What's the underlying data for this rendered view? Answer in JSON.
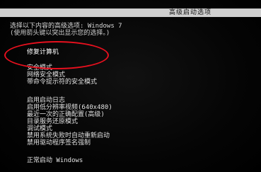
{
  "header": {
    "title": "高级启动选项"
  },
  "prompt": {
    "line1": "选择以下内容的高级选项: Windows 7",
    "line2": "(使用箭头键以突出显示您的选择。)"
  },
  "menu": {
    "repair": [
      {
        "label": "修复计算机",
        "selected": true
      }
    ],
    "safe": [
      {
        "label": "安全模式"
      },
      {
        "label": "网络安全模式"
      },
      {
        "label": "带命令提示符的安全模式"
      }
    ],
    "advanced": [
      {
        "label": "启用启动日志"
      },
      {
        "label": "启用低分辨率视频(640x480)"
      },
      {
        "label": "最近一次的正确配置(高级)"
      },
      {
        "label": "目录服务还原模式"
      },
      {
        "label": "调试模式"
      },
      {
        "label": "禁用系统失败时自动重新启动"
      },
      {
        "label": "禁用驱动程序签名强制"
      }
    ],
    "normal": [
      {
        "label": "正常启动 Windows"
      }
    ]
  },
  "annotation": {
    "color": "#e8101e"
  }
}
